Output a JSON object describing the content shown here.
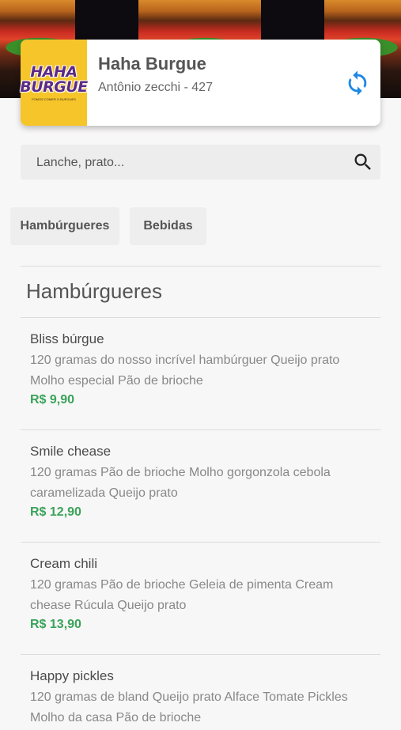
{
  "store": {
    "logo_text_line1": "HAHA",
    "logo_text_line2": "BURGUE",
    "logo_tagline": "FOMOS COMER O BURGUES",
    "name": "Haha Burgue",
    "address": "Antônio zecchi - 427",
    "refresh_icon": "refresh-icon"
  },
  "search": {
    "placeholder": "Lanche, prato...",
    "icon": "search-icon"
  },
  "categories": [
    {
      "label": "Hambúrgueres"
    },
    {
      "label": "Bebidas"
    }
  ],
  "section": {
    "title": "Hambúrgueres"
  },
  "items": [
    {
      "name": "Bliss búrgue",
      "description": "120 gramas do nosso incrível hambúrguer Queijo prato Molho especial Pão de brioche",
      "price": "R$ 9,90"
    },
    {
      "name": "Smile chease",
      "description": "120 gramas Pão de brioche Molho gorgonzola cebola caramelizada Queijo prato",
      "price": "R$ 12,90"
    },
    {
      "name": "Cream chili",
      "description": "120 gramas Pão de brioche Geleia de pimenta Cream chease Rúcula Queijo prato",
      "price": "R$ 13,90"
    },
    {
      "name": "Happy pickles",
      "description": "120 gramas de bland Queijo prato Alface Tomate Pickles Molho da casa Pão de brioche",
      "price": ""
    }
  ],
  "colors": {
    "accent_blue": "#1e88e5",
    "price_green": "#3aa35a",
    "logo_yellow": "#f6c52a",
    "logo_purple": "#5b2a86"
  }
}
